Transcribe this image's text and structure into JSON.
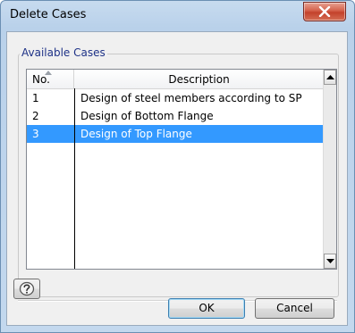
{
  "window": {
    "title": "Delete Cases",
    "close_icon": "close-x-icon"
  },
  "group": {
    "label": "Available Cases"
  },
  "table": {
    "columns": [
      "No.",
      "Description"
    ],
    "sort_icon": "sort-ascending-icon",
    "rows": [
      {
        "no": "1",
        "description": "Design of steel members according to SP"
      },
      {
        "no": "2",
        "description": "Design of Bottom Flange"
      },
      {
        "no": "3",
        "description": "Design of Top Flange",
        "selected": true
      }
    ]
  },
  "buttons": {
    "help_icon": "help-icon",
    "ok": "OK",
    "cancel": "Cancel"
  },
  "colors": {
    "selection": "#3399ff",
    "group_label": "#1e3287",
    "close_button": "#c3412b"
  }
}
